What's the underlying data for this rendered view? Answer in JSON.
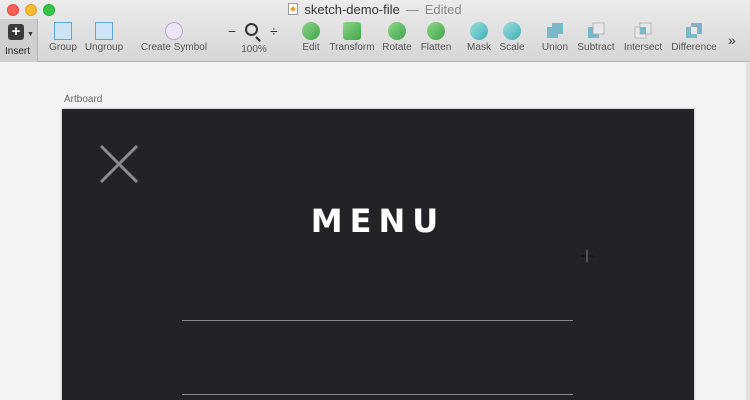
{
  "window": {
    "title": "sketch-demo-file",
    "separator": "—",
    "status": "Edited"
  },
  "toolbar": {
    "insert": "Insert",
    "group": "Group",
    "ungroup": "Ungroup",
    "create_symbol": "Create Symbol",
    "zoom_minus": "−",
    "zoom_plus": "÷",
    "zoom_level": "100%",
    "edit": "Edit",
    "transform": "Transform",
    "rotate": "Rotate",
    "flatten": "Flatten",
    "mask": "Mask",
    "scale": "Scale",
    "union": "Union",
    "subtract": "Subtract",
    "intersect": "Intersect",
    "difference": "Difference",
    "more": "»"
  },
  "canvas": {
    "artboard_label": "Artboard",
    "menu_title": "MENU"
  },
  "colors": {
    "artboard_bg": "#232326",
    "menu_text": "#ffffff",
    "divider": "#8a8a8a",
    "close_icon": "#8c8c8c"
  }
}
